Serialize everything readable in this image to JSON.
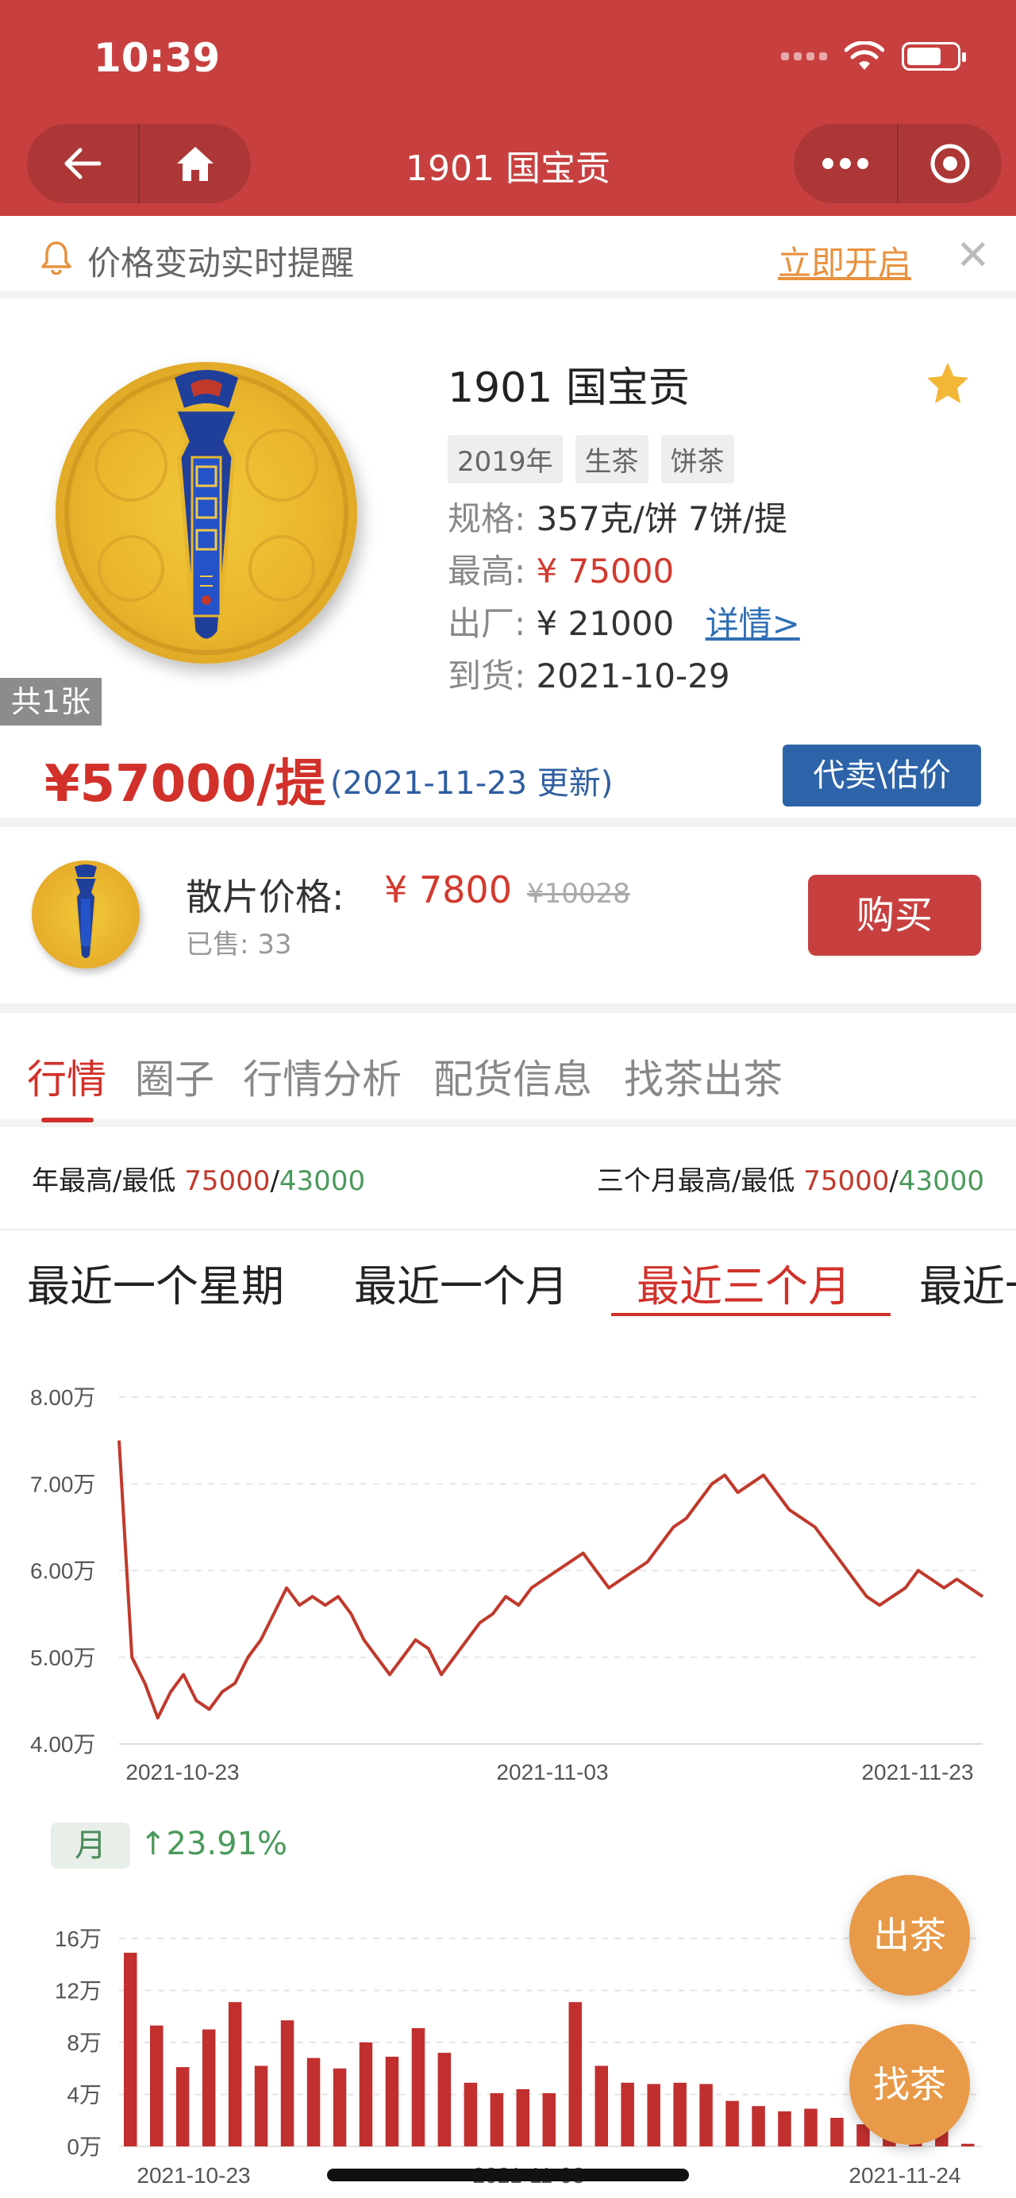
{
  "status": {
    "time": "10:39"
  },
  "nav": {
    "title": "1901 国宝贡"
  },
  "alert": {
    "text": "价格变动实时提醒",
    "action": "立即开启",
    "close": "✕"
  },
  "product": {
    "photo_count": "共1张",
    "title": "1901 国宝贡",
    "tags": [
      "2019年",
      "生茶",
      "饼茶"
    ],
    "spec_label": "规格:",
    "spec_value": "357克/饼 7饼/提",
    "max_label": "最高:",
    "max_value": "¥ 75000",
    "factory_label": "出厂:",
    "factory_value": "¥ 21000",
    "detail_link": "详情>",
    "arrival_label": "到货:",
    "arrival_value": "2021-10-29",
    "price": "¥57000/提",
    "updated": "(2021-11-23 更新)",
    "sell_button": "代卖\\估价"
  },
  "loose": {
    "label": "散片价格:",
    "price": "¥ 7800",
    "original": "¥10028",
    "sold": "已售: 33",
    "buy_button": "购买"
  },
  "tabs": [
    "行情",
    "圈子",
    "行情分析",
    "配货信息",
    "找茶出茶"
  ],
  "highlights": {
    "year_label": "年最高/最低",
    "year_high": "75000",
    "year_low": "43000",
    "quarter_label": "三个月最高/最低",
    "quarter_high": "75000",
    "quarter_low": "43000",
    "slash": "/"
  },
  "range_tabs": [
    "最近一个星期",
    "最近一个月",
    "最近三个月",
    "最近一年"
  ],
  "change": {
    "period": "月",
    "value": "↑23.91%"
  },
  "fab": {
    "sell": "出茶",
    "find": "找茶"
  },
  "colors": {
    "brand_red": "#c7403f",
    "price_red": "#d2302a",
    "link_blue": "#2f6fb4",
    "accent_orange": "#e8913f",
    "green": "#4a9a5c"
  },
  "chart_data": [
    {
      "type": "line",
      "ylim": [
        40000,
        80000
      ],
      "yticks": [
        "4.00万",
        "5.00万",
        "6.00万",
        "7.00万",
        "8.00万"
      ],
      "xticks": [
        "2021-10-23",
        "2021-11-03",
        "2021-11-23"
      ],
      "values": [
        75000,
        50000,
        47000,
        43000,
        46000,
        48000,
        45000,
        44000,
        46000,
        47000,
        50000,
        52000,
        55000,
        58000,
        56000,
        57000,
        56000,
        57000,
        55000,
        52000,
        50000,
        48000,
        50000,
        52000,
        51000,
        48000,
        50000,
        52000,
        54000,
        55000,
        57000,
        56000,
        58000,
        59000,
        60000,
        61000,
        62000,
        60000,
        58000,
        59000,
        60000,
        61000,
        63000,
        65000,
        66000,
        68000,
        70000,
        71000,
        69000,
        70000,
        71000,
        69000,
        67000,
        66000,
        65000,
        63000,
        61000,
        59000,
        57000,
        56000,
        57000,
        58000,
        60000,
        59000,
        58000,
        59000,
        58000,
        57000
      ]
    },
    {
      "type": "bar",
      "ylim": [
        0,
        180000
      ],
      "yticks": [
        "0万",
        "4万",
        "8万",
        "12万",
        "16万"
      ],
      "xticks": [
        "2021-10-23",
        "2021-11-03",
        "2021-11-24"
      ],
      "values": [
        149000,
        93000,
        61000,
        90000,
        111000,
        62000,
        97000,
        68000,
        60000,
        80000,
        69000,
        91000,
        72000,
        49000,
        41000,
        44000,
        41000,
        111000,
        62000,
        49000,
        48000,
        49000,
        48000,
        35000,
        31000,
        27000,
        29000,
        22000,
        17000,
        15000,
        12000,
        13000,
        2000
      ]
    }
  ]
}
